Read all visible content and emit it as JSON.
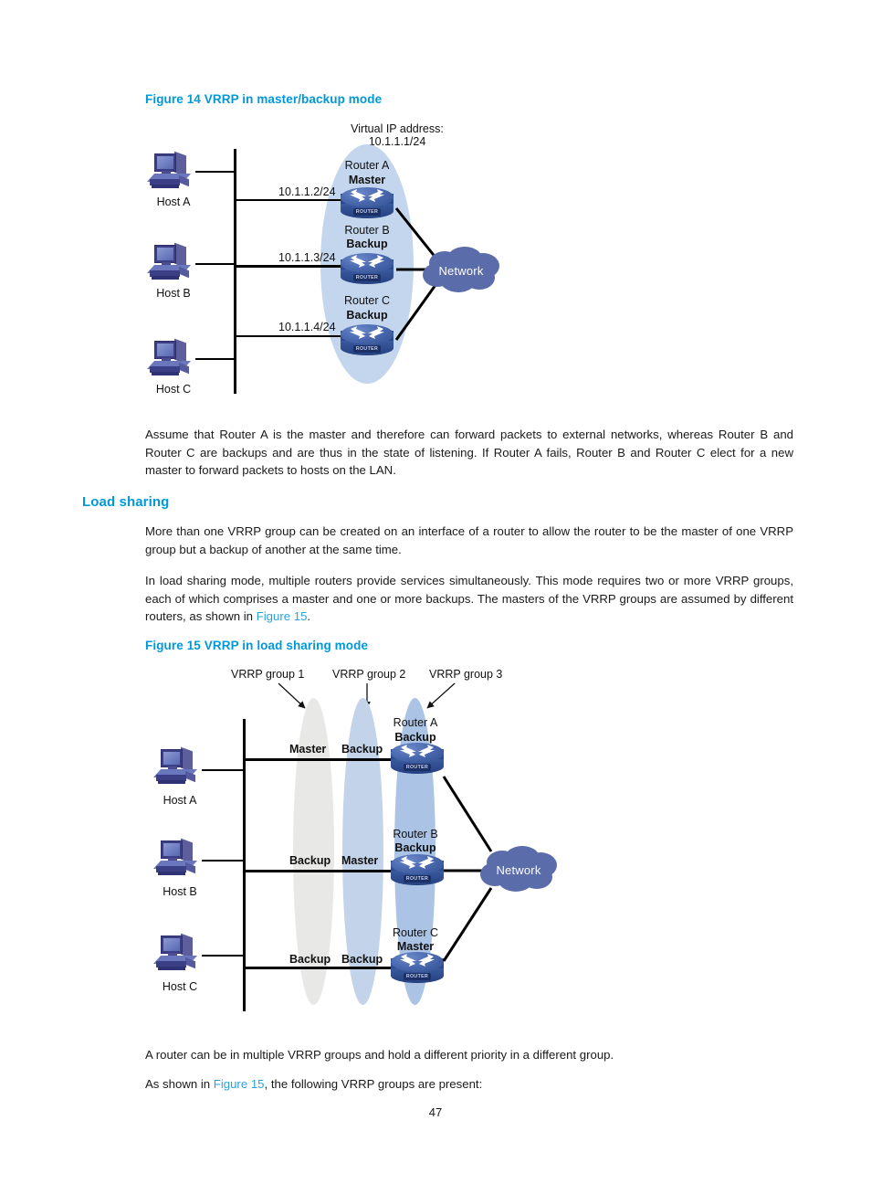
{
  "page": {
    "number": "47"
  },
  "figure14": {
    "caption": "Figure 14 VRRP in master/backup mode",
    "virtual_ip_line1": "Virtual IP address:",
    "virtual_ip_line2": "10.1.1.1/24",
    "hosts": [
      {
        "label": "Host A",
        "ip": "10.1.1.2/24"
      },
      {
        "label": "Host B",
        "ip": "10.1.1.3/24"
      },
      {
        "label": "Host C",
        "ip": "10.1.1.4/24"
      }
    ],
    "routers": [
      {
        "name": "Router A",
        "state": "Master"
      },
      {
        "name": "Router B",
        "state": "Backup"
      },
      {
        "name": "Router C",
        "state": "Backup"
      }
    ],
    "cloud_label": "Network",
    "router_icon_text": "ROUTER"
  },
  "paragraph1": "Assume that Router A is the master and therefore can forward packets to external networks, whereas Router B and Router C are backups and are thus in the state of listening. If Router A fails, Router B and Router C elect for a new master to forward packets to hosts on the LAN.",
  "load_sharing": {
    "heading": "Load sharing",
    "paragraph1": "More than one VRRP group can be created on an interface of a router to allow the router to be the master of one VRRP group but a backup of another at the same time.",
    "paragraph2_part1": "In load sharing mode, multiple routers provide services simultaneously. This mode requires two or more VRRP groups, each of which comprises a master and one or more backups. The masters of the VRRP groups are assumed by different routers, as shown in ",
    "paragraph2_link": "Figure 15",
    "paragraph2_part2": "."
  },
  "figure15": {
    "caption": "Figure 15 VRRP in load sharing mode",
    "group_labels": [
      "VRRP group 1",
      "VRRP group 2",
      "VRRP group 3"
    ],
    "hosts": [
      {
        "label": "Host A"
      },
      {
        "label": "Host B"
      },
      {
        "label": "Host C"
      }
    ],
    "routers": [
      {
        "name": "Router A",
        "state": "Backup",
        "group_states": [
          "Master",
          "Backup"
        ]
      },
      {
        "name": "Router B",
        "state": "Backup",
        "group_states": [
          "Backup",
          "Master"
        ]
      },
      {
        "name": "Router C",
        "state": "Master",
        "group_states": [
          "Backup",
          "Backup"
        ]
      }
    ],
    "cloud_label": "Network",
    "router_icon_text": "ROUTER"
  },
  "closing": {
    "paragraph1": "A router can be in multiple VRRP groups and hold a different priority in a different group.",
    "paragraph2_part1": "As shown in ",
    "paragraph2_link": "Figure 15",
    "paragraph2_part2": ", the following VRRP groups are present:"
  },
  "colors": {
    "heading_blue": "#0098d8",
    "link_blue": "#2aa3dd",
    "cloud_blue": "#5b6cab",
    "ellipse_blue": "#c3d6ed",
    "group1_gray": "#e8e8e6",
    "group2_blue": "#c2d3ea",
    "group3_blue": "#abc3e4",
    "router_blue": "#2d4a90"
  }
}
